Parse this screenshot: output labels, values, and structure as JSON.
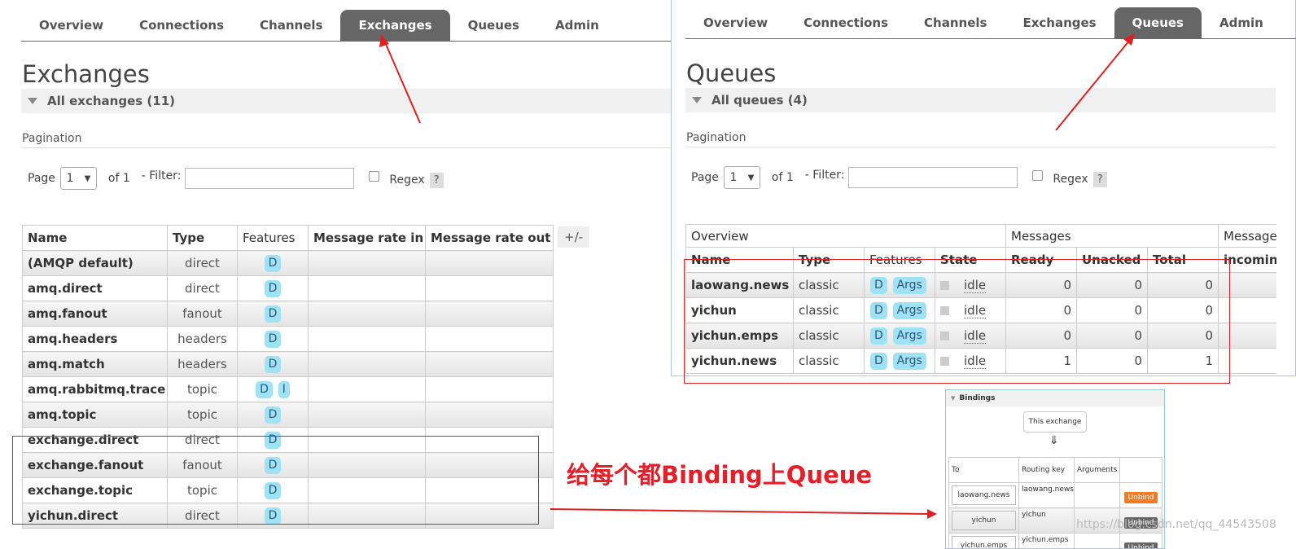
{
  "left": {
    "nav_tabs": [
      "Overview",
      "Connections",
      "Channels",
      "Exchanges",
      "Queues",
      "Admin"
    ],
    "active_tab": "Exchanges",
    "title": "Exchanges",
    "section": "All exchanges (11)",
    "pagination_label": "Pagination",
    "page_label": "Page",
    "page_value": "1",
    "of_label": "of 1",
    "filter_label": "- Filter:",
    "regex_label": "Regex",
    "help_label": "?",
    "plus_minus": "+/-",
    "columns": [
      "Name",
      "Type",
      "Features",
      "Message rate in",
      "Message rate out"
    ],
    "rows": [
      {
        "name": "(AMQP default)",
        "type": "direct",
        "features": [
          "D"
        ]
      },
      {
        "name": "amq.direct",
        "type": "direct",
        "features": [
          "D"
        ]
      },
      {
        "name": "amq.fanout",
        "type": "fanout",
        "features": [
          "D"
        ]
      },
      {
        "name": "amq.headers",
        "type": "headers",
        "features": [
          "D"
        ]
      },
      {
        "name": "amq.match",
        "type": "headers",
        "features": [
          "D"
        ]
      },
      {
        "name": "amq.rabbitmq.trace",
        "type": "topic",
        "features": [
          "D",
          "I"
        ]
      },
      {
        "name": "amq.topic",
        "type": "topic",
        "features": [
          "D"
        ]
      },
      {
        "name": "exchange.direct",
        "type": "direct",
        "features": [
          "D"
        ]
      },
      {
        "name": "exchange.fanout",
        "type": "fanout",
        "features": [
          "D"
        ]
      },
      {
        "name": "exchange.topic",
        "type": "topic",
        "features": [
          "D"
        ]
      },
      {
        "name": "yichun.direct",
        "type": "direct",
        "features": [
          "D"
        ]
      }
    ]
  },
  "right": {
    "nav_tabs": [
      "Overview",
      "Connections",
      "Channels",
      "Exchanges",
      "Queues",
      "Admin"
    ],
    "active_tab": "Queues",
    "title": "Queues",
    "section": "All queues (4)",
    "pagination_label": "Pagination",
    "page_label": "Page",
    "page_value": "1",
    "of_label": "of 1",
    "filter_label": "- Filter:",
    "regex_label": "Regex",
    "help_label": "?",
    "group_headers": [
      "Overview",
      "Messages",
      "Message"
    ],
    "columns": [
      "Name",
      "Type",
      "Features",
      "State",
      "Ready",
      "Unacked",
      "Total",
      "incomin"
    ],
    "rows": [
      {
        "name": "laowang.news",
        "type": "classic",
        "features": [
          "D",
          "Args"
        ],
        "state": "idle",
        "ready": "0",
        "unacked": "0",
        "total": "0"
      },
      {
        "name": "yichun",
        "type": "classic",
        "features": [
          "D",
          "Args"
        ],
        "state": "idle",
        "ready": "0",
        "unacked": "0",
        "total": "0"
      },
      {
        "name": "yichun.emps",
        "type": "classic",
        "features": [
          "D",
          "Args"
        ],
        "state": "idle",
        "ready": "0",
        "unacked": "0",
        "total": "0"
      },
      {
        "name": "yichun.news",
        "type": "classic",
        "features": [
          "D",
          "Args"
        ],
        "state": "idle",
        "ready": "1",
        "unacked": "0",
        "total": "1"
      }
    ]
  },
  "annotation": "给每个都Binding上Queue",
  "bindings": {
    "title": "Bindings",
    "this_exchange": "This exchange",
    "arrow": "⇓",
    "columns": [
      "To",
      "Routing key",
      "Arguments"
    ],
    "rows": [
      {
        "to": "laowang.news",
        "key": "laowang.news",
        "action": "Unbind"
      },
      {
        "to": "yichun",
        "key": "yichun",
        "action": "Unbind"
      },
      {
        "to": "yichun.emps",
        "key": "yichun.emps",
        "action": "Unbind"
      }
    ]
  },
  "watermark": "https://blog.csdn.net/qq_44543508",
  "colors": {
    "annotation_red": "#e61e28",
    "active_tab": "#666666",
    "badge": "#9ee2f5",
    "unbind_orange": "#f47b20",
    "unbind_gray": "#666666"
  }
}
